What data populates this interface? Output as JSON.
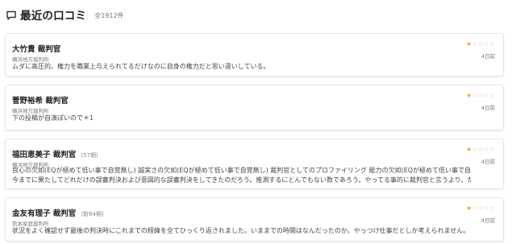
{
  "header": {
    "title": "最近の口コミ",
    "total": "全1912件"
  },
  "reviews": [
    {
      "name": "大竹貴 裁判官",
      "term": "",
      "court": "横浜地方裁判所",
      "comment_lines": [
        "ムダに高圧的。権力を職業上与えられてるだけなのに自身の権力だと思い違いしている。"
      ],
      "rating": 1,
      "max_rating": 5,
      "date": "4日前"
    },
    {
      "name": "菅野裕希 裁判官",
      "term": "",
      "court": "横浜地方裁判所",
      "comment_lines": [
        "下の投稿が自演ぽいので＊1"
      ],
      "rating": 1,
      "max_rating": 5,
      "date": "4日前"
    },
    {
      "name": "福田恵美子 裁判官",
      "term": "(57期)",
      "court": "横浜地方裁判所",
      "comment_lines": [
        "良心の欠如(EQが極めて低い事で自覚無し) 誠実さの欠如(EQが極めて低い事で自覚無し) 裁判官としてのプロファイリング 能力の欠如(EQが極めて低い事で自覚無し) こやつは",
        "今までに果たしてどれだけの誤審判決および意図的な誤審判決をしてきたのだろう。推測するにとんでもない数であろう。やってる事的に裁判官と言うより、ただのその辺の…"
      ],
      "rating": 1,
      "max_rating": 5,
      "date": "4日前"
    },
    {
      "name": "金友有理子 裁判官",
      "term": "(新64期)",
      "court": "熊本家庭裁判所",
      "comment_lines": [
        "状況をよく確認せず最後の判決時にこれまでの経緯を全てひっくり返されました。いままでの時間はなんだったのか。やっつけ仕事だとしか考えられません。"
      ],
      "rating": 1,
      "max_rating": 5,
      "date": "4日前"
    }
  ]
}
